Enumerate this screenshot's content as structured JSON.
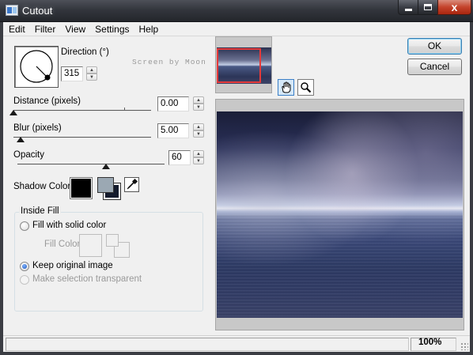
{
  "window": {
    "title": "Cutout",
    "minimize_label": "",
    "maximize_label": "",
    "close_label": "x"
  },
  "menu": {
    "items": [
      "Edit",
      "Filter",
      "View",
      "Settings",
      "Help"
    ]
  },
  "direction": {
    "label": "Direction (°)",
    "value": "315"
  },
  "watermark": "Screen by Moon",
  "distance": {
    "label": "Distance (pixels)",
    "value": "0.00",
    "slider_fraction": 0.0
  },
  "blur": {
    "label": "Blur (pixels)",
    "value": "5.00",
    "slider_fraction": 0.05
  },
  "opacity": {
    "label": "Opacity",
    "value": "60",
    "slider_fraction": 0.6
  },
  "shadow_color": {
    "label": "Shadow Color",
    "main_color": "#000000",
    "front_color": "#9ba8b3",
    "back_color": "#131a2c"
  },
  "inside_fill": {
    "title": "Inside Fill",
    "option_solid": "Fill with solid color",
    "fill_color_label": "Fill Color",
    "option_keep": "Keep original image",
    "option_transparent": "Make selection transparent",
    "selected": "keep"
  },
  "buttons": {
    "ok": "OK",
    "cancel": "Cancel"
  },
  "tools": {
    "pan": "hand-icon",
    "zoom": "magnifier-icon"
  },
  "status": {
    "zoom": "100%"
  },
  "colors": {
    "selection_outline": "#e53a3a",
    "titlebar": "#33363d"
  }
}
